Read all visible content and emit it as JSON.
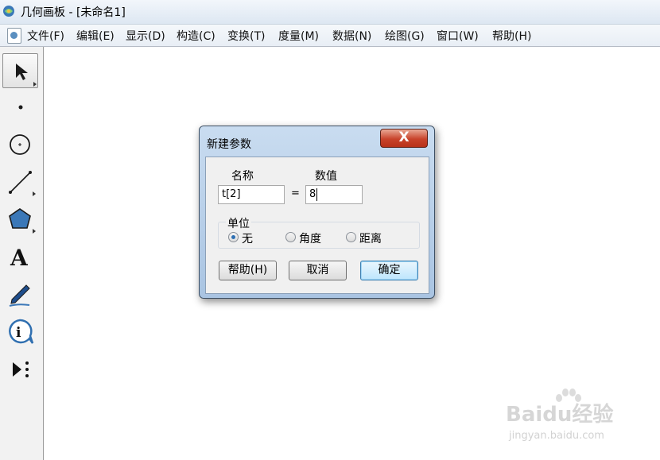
{
  "window": {
    "title": "几何画板 - [未命名1]"
  },
  "menu": [
    "文件(F)",
    "编辑(E)",
    "显示(D)",
    "构造(C)",
    "变换(T)",
    "度量(M)",
    "数据(N)",
    "绘图(G)",
    "窗口(W)",
    "帮助(H)"
  ],
  "toolbox": [
    "select-arrow-icon",
    "point-icon",
    "compass-circle-icon",
    "straightedge-line-icon",
    "polygon-icon",
    "text-icon",
    "marker-pen-icon",
    "information-icon",
    "custom-tool-icon"
  ],
  "dialog": {
    "title": "新建参数",
    "close_label": "X",
    "name_label": "名称",
    "value_label": "数值",
    "name_value": "t[2]",
    "equals": "=",
    "value_value": "8",
    "unit_label": "单位",
    "units": [
      "无",
      "角度",
      "距离"
    ],
    "selected_unit": "无",
    "help_button": "帮助(H)",
    "cancel_button": "取消",
    "ok_button": "确定"
  },
  "watermark": {
    "main": "Baidu经验",
    "sub": "jingyan.baidu.com"
  }
}
